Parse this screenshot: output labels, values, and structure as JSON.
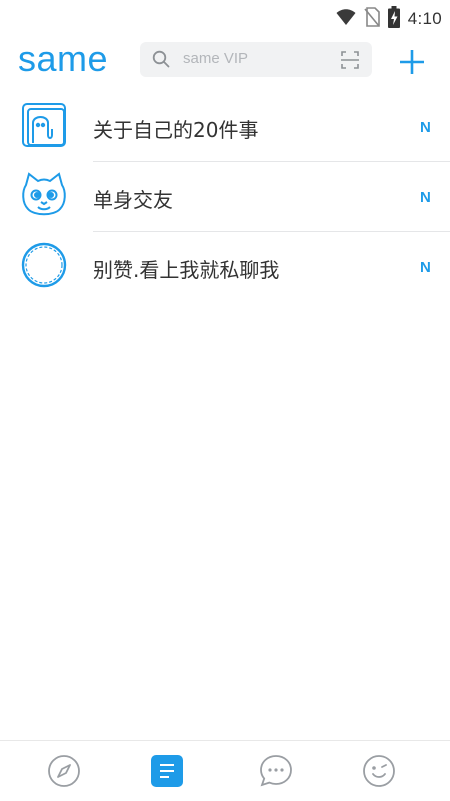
{
  "status_bar": {
    "time": "4:10",
    "icons": [
      "wifi-icon",
      "no-sim-icon",
      "battery-charging-icon"
    ]
  },
  "header": {
    "logo_text": "same",
    "search": {
      "placeholder": "same VIP",
      "left_icon": "search-icon",
      "right_icon": "scan-icon"
    },
    "add_icon": "plus-icon"
  },
  "colors": {
    "brand": "#1e9be8",
    "text": "#333333",
    "muted": "#b3b6ba",
    "divider": "#e5e6e8"
  },
  "channels": [
    {
      "title": "关于自己的20件事",
      "badge": "N",
      "icon": "notebook-ghost-icon"
    },
    {
      "title": "单身交友",
      "badge": "N",
      "icon": "cat-face-icon"
    },
    {
      "title": "别赞.看上我就私聊我",
      "badge": "N",
      "icon": "ring-icon"
    }
  ],
  "bottom_nav": [
    {
      "name": "explore",
      "icon": "compass-icon",
      "active": false
    },
    {
      "name": "channels",
      "icon": "list-icon",
      "active": true
    },
    {
      "name": "messages",
      "icon": "chat-bubble-icon",
      "active": false
    },
    {
      "name": "profile",
      "icon": "smiley-icon",
      "active": false
    }
  ]
}
